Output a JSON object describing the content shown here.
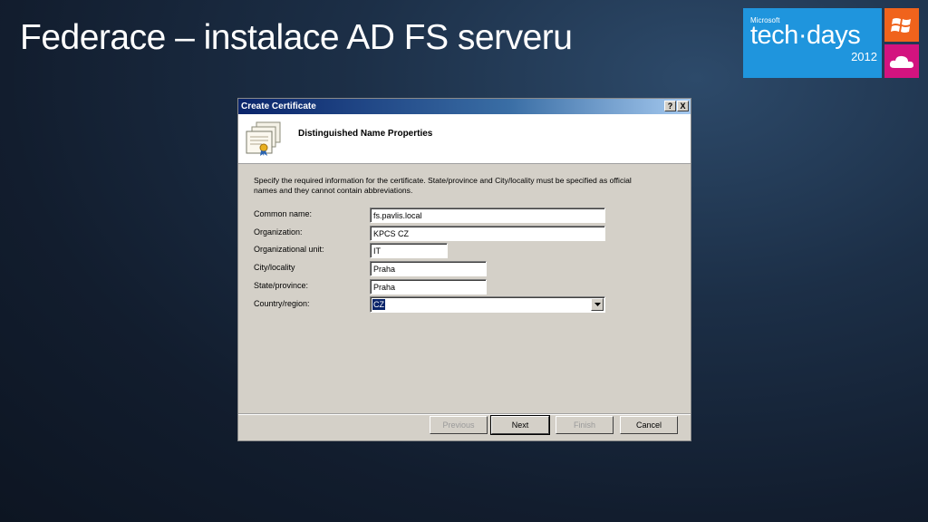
{
  "slide": {
    "title": "Federace – instalace AD FS serveru"
  },
  "logo": {
    "brand": "Microsoft",
    "wordmark": "tech·days",
    "year": "2012",
    "colors": {
      "main": "#1f95dd",
      "top_tile": "#f0631c",
      "bottom_tile": "#d3137f"
    },
    "icons": [
      "windows-icon",
      "cloud-icon"
    ]
  },
  "dialog": {
    "title": "Create Certificate",
    "help_label": "?",
    "close_label": "X",
    "header_title": "Distinguished Name Properties",
    "header_icon": "certificate-icon",
    "instructions": "Specify the required information for the certificate. State/province and City/locality must be specified as official names and they cannot contain abbreviations.",
    "fields": {
      "common_name": {
        "label": "Common name:",
        "value": "fs.pavlis.local"
      },
      "organization": {
        "label": "Organization:",
        "value": "KPCS CZ"
      },
      "organizational_unit": {
        "label": "Organizational unit:",
        "value": "IT"
      },
      "city": {
        "label": "City/locality",
        "value": "Praha"
      },
      "state": {
        "label": "State/province:",
        "value": "Praha"
      },
      "country": {
        "label": "Country/region:",
        "value": "CZ"
      }
    },
    "buttons": {
      "previous": "Previous",
      "next": "Next",
      "finish": "Finish",
      "cancel": "Cancel"
    }
  }
}
